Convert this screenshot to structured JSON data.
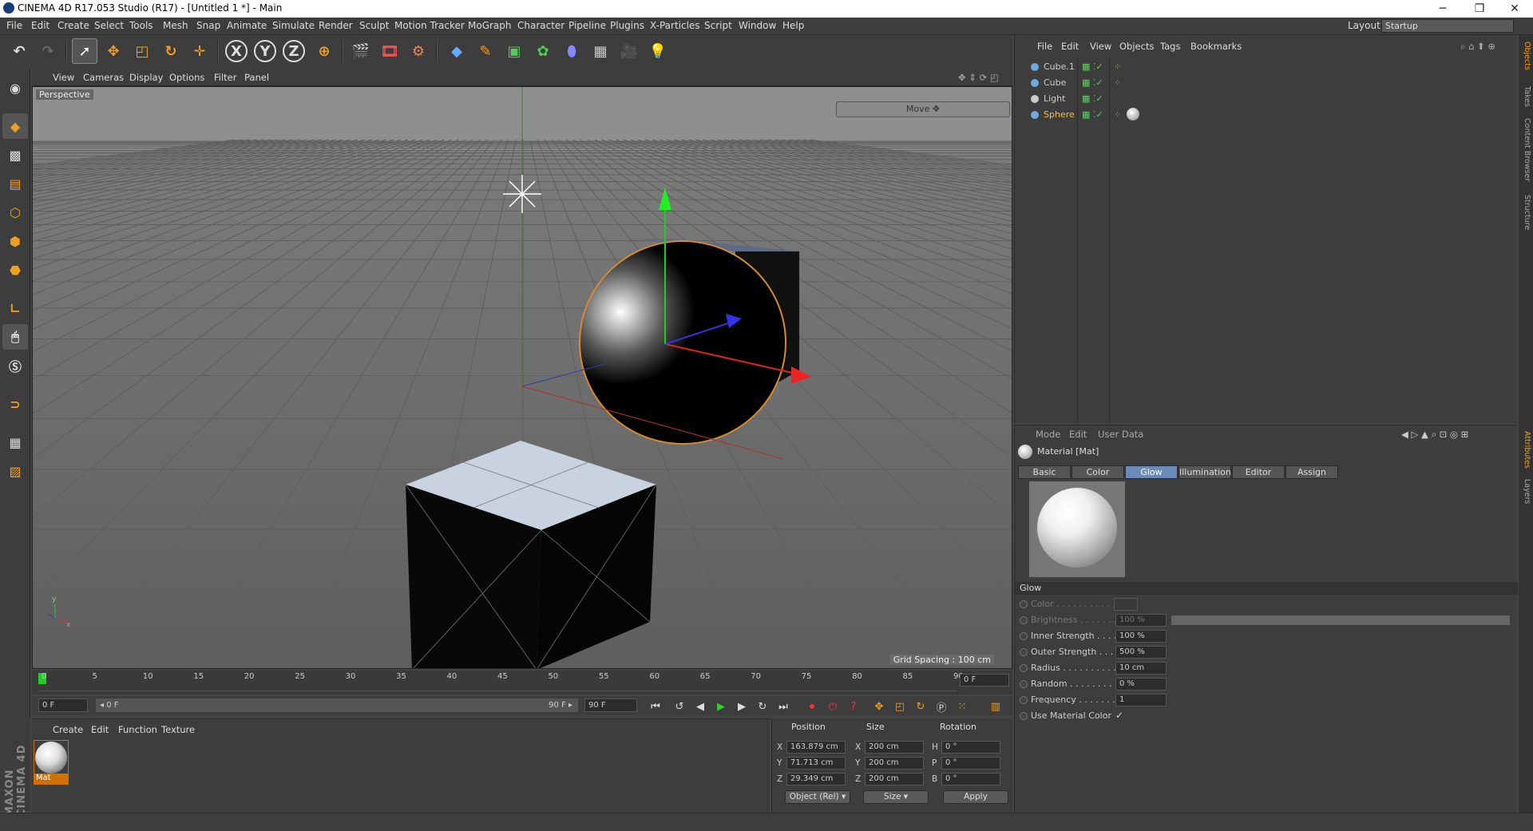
{
  "window": {
    "title": "CINEMA 4D R17.053 Studio (R17) - [Untitled 1 *] - Main",
    "minimize": "─",
    "maximize": "❐",
    "close": "✕"
  },
  "menubar": {
    "items": [
      "File",
      "Edit",
      "Create",
      "Select",
      "Tools",
      "Mesh",
      "Snap",
      "Animate",
      "Simulate",
      "Render",
      "Sculpt",
      "Motion Tracker",
      "MoGraph",
      "Character",
      "Pipeline",
      "Plugins",
      "X-Particles",
      "Script",
      "Window",
      "Help"
    ],
    "layout_label": "Layout:",
    "layout_value": "Startup"
  },
  "toolbar": {
    "axis_x": "X",
    "axis_y": "Y",
    "axis_z": "Z"
  },
  "viewport": {
    "menu": [
      "View",
      "Cameras",
      "Display",
      "Options",
      "Filter",
      "Panel"
    ],
    "label": "Perspective",
    "move_box": "Move ✥",
    "grid_spacing": "Grid Spacing : 100 cm"
  },
  "timeline": {
    "ticks": [
      "0",
      "5",
      "10",
      "15",
      "20",
      "25",
      "30",
      "35",
      "40",
      "45",
      "50",
      "55",
      "60",
      "65",
      "70",
      "75",
      "80",
      "85",
      "90"
    ],
    "current_frame": "0 F",
    "start_field": "0 F",
    "range_start": "◂ 0 F",
    "range_end": "90 F ▸",
    "end_field": "90 F"
  },
  "material_manager": {
    "menu": [
      "Create",
      "Edit",
      "Function",
      "Texture"
    ],
    "material_name": "Mat"
  },
  "coordinates": {
    "headers": [
      "Position",
      "Size",
      "Rotation"
    ],
    "rows": [
      {
        "axis": "X",
        "pos": "163.879 cm",
        "size_axis": "X",
        "size": "200 cm",
        "rot_axis": "H",
        "rot": "0 °"
      },
      {
        "axis": "Y",
        "pos": "71.713 cm",
        "size_axis": "Y",
        "size": "200 cm",
        "rot_axis": "P",
        "rot": "0 °"
      },
      {
        "axis": "Z",
        "pos": "29.349 cm",
        "size_axis": "Z",
        "size": "200 cm",
        "rot_axis": "B",
        "rot": "0 °"
      }
    ],
    "mode_select": "Object (Rel) ▾",
    "size_select": "Size ▾",
    "apply": "Apply"
  },
  "object_manager": {
    "menu": [
      "File",
      "Edit",
      "View",
      "Objects",
      "Tags",
      "Bookmarks"
    ],
    "objects": [
      {
        "name": "Cube.1",
        "color": "#6fa8dc",
        "selected": false
      },
      {
        "name": "Cube",
        "color": "#6fa8dc",
        "selected": false
      },
      {
        "name": "Light",
        "color": "#cccccc",
        "selected": false
      },
      {
        "name": "Sphere",
        "color": "#6fa8dc",
        "selected": true
      }
    ]
  },
  "attribute_manager": {
    "menu": [
      "Mode",
      "Edit",
      "User Data"
    ],
    "title": "Material [Mat]",
    "tabs": [
      "Basic",
      "Color",
      "Glow",
      "Illumination",
      "Editor",
      "Assign"
    ],
    "active_tab": "Glow",
    "section": "Glow",
    "params": [
      {
        "label": "Color . . . . . . . . . .",
        "value": "",
        "enabled": false
      },
      {
        "label": "Brightness . . . . . . .",
        "value": "100 %",
        "enabled": false
      },
      {
        "label": "Inner Strength . . . .",
        "value": "100 %",
        "enabled": true
      },
      {
        "label": "Outer Strength . . .",
        "value": "500 %",
        "enabled": true
      },
      {
        "label": "Radius . . . . . . . . . .",
        "value": "10 cm",
        "enabled": true
      },
      {
        "label": "Random . . . . . . . . .",
        "value": "0 %",
        "enabled": true
      },
      {
        "label": "Frequency . . . . . . . .",
        "value": "1",
        "enabled": true
      },
      {
        "label": "Use Material Color",
        "value": "✓",
        "enabled": true
      }
    ]
  },
  "side_tabs": [
    "Objects",
    "Takes",
    "Content Browser",
    "Structure",
    "Attributes",
    "Layers"
  ],
  "branding": "MAXON CINEMA 4D",
  "colors": {
    "accent": "#d07000",
    "selected_text": "#f0c050",
    "active_tab": "#6b8ab8"
  }
}
